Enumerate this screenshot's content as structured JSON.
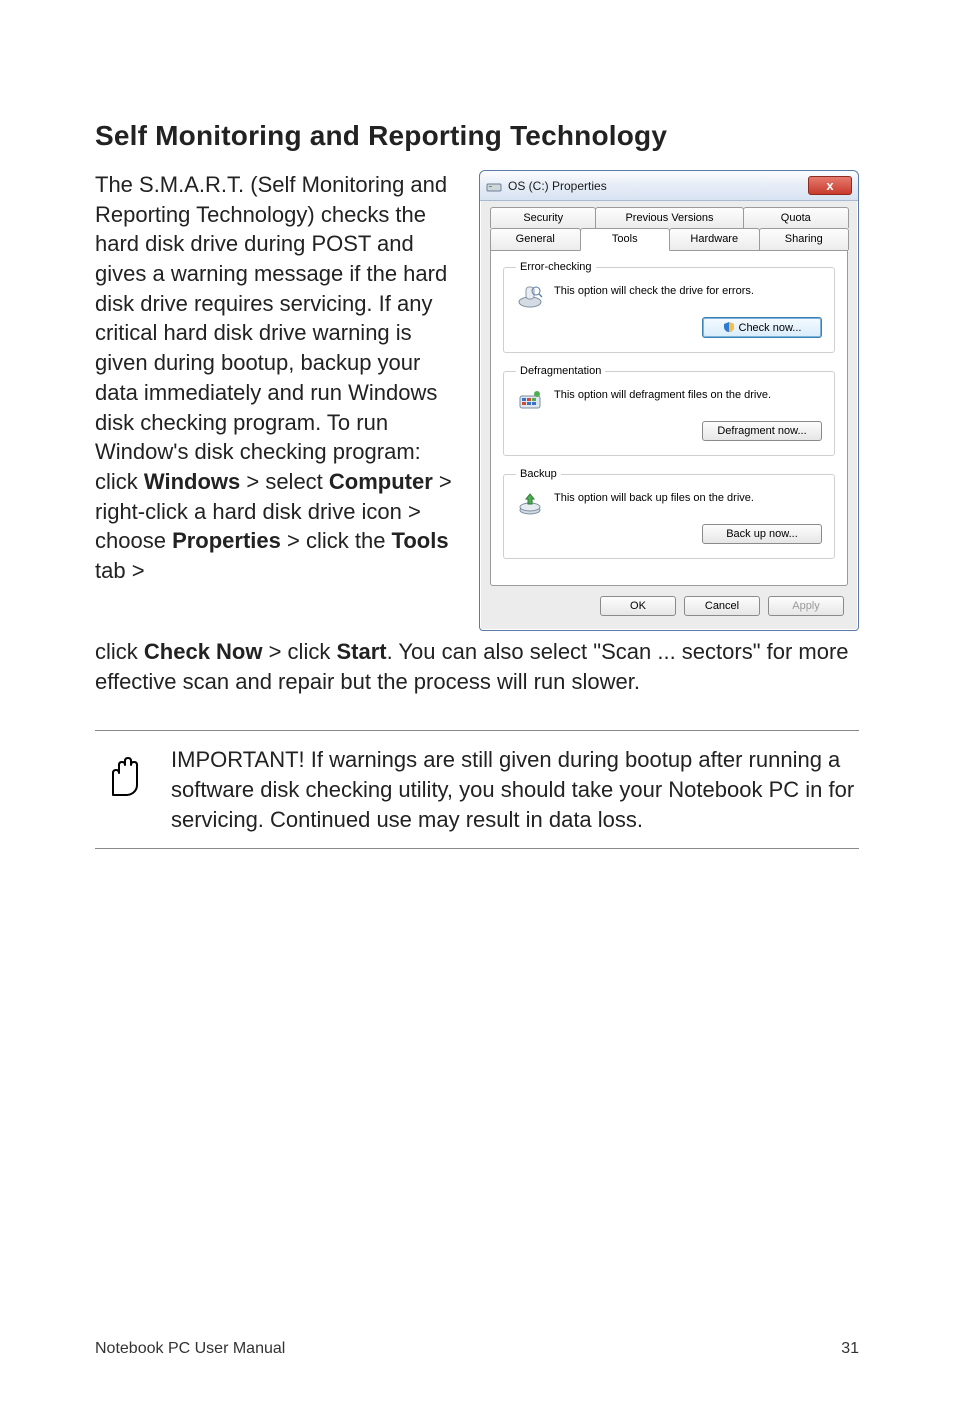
{
  "section_title": "Self Monitoring and Reporting Technology",
  "intro": {
    "p1a": "The S.M.A.R.T. (Self Monitoring and Reporting Technology) checks the hard disk drive during POST and gives a warning message if the hard disk drive requires servicing. If any critical hard disk drive warning is given during bootup, backup your data immediately and run Windows disk checking program. To run Window's disk checking program: click ",
    "w_windows": "Windows",
    "gt1": " > select ",
    "w_computer": "Computer",
    "gt2": " > right-click a hard disk drive icon > choose ",
    "w_properties": "Properties",
    "gt3": " > click the ",
    "w_tools": "Tools",
    "gt4": " tab > "
  },
  "after": {
    "a1": "click ",
    "w_checknow": "Check Now",
    "a2": " > click ",
    "w_start": "Start",
    "a3": ". You can also select \"Scan ... sectors\" for more effective scan and repair but the process will run slower."
  },
  "note": "IMPORTANT! If warnings are still given during bootup after running a software disk checking utility, you should take your Notebook PC in for servicing. Continued use may result in data loss.",
  "footer_left": "Notebook PC User Manual",
  "footer_right": "31",
  "dialog": {
    "title": "OS (C:) Properties",
    "close_label": "x",
    "tabs_back": [
      "Security",
      "Previous Versions",
      "Quota"
    ],
    "tabs_front": [
      "General",
      "Tools",
      "Hardware",
      "Sharing"
    ],
    "active_tab": "Tools",
    "groups": {
      "error": {
        "legend": "Error-checking",
        "desc": "This option will check the drive for errors.",
        "button": "Check now..."
      },
      "defrag": {
        "legend": "Defragmentation",
        "desc": "This option will defragment files on the drive.",
        "button": "Defragment now..."
      },
      "backup": {
        "legend": "Backup",
        "desc": "This option will back up files on the drive.",
        "button": "Back up now..."
      }
    },
    "buttons": {
      "ok": "OK",
      "cancel": "Cancel",
      "apply": "Apply"
    }
  }
}
